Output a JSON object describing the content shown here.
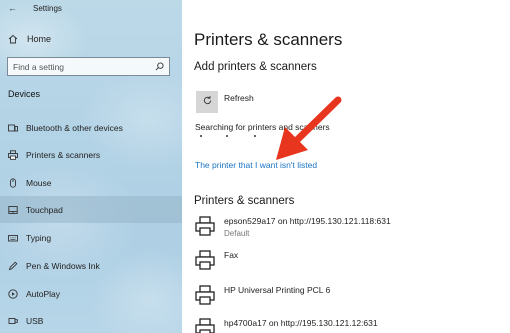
{
  "window": {
    "title": "Settings"
  },
  "sidebar": {
    "home_label": "Home",
    "search": {
      "placeholder": "Find a setting",
      "value": ""
    },
    "section_label": "Devices",
    "items": [
      {
        "label": "Bluetooth & other devices",
        "icon": "bluetooth-devices-icon"
      },
      {
        "label": "Printers & scanners",
        "icon": "printer-icon"
      },
      {
        "label": "Mouse",
        "icon": "mouse-icon"
      },
      {
        "label": "Touchpad",
        "icon": "touchpad-icon",
        "active": true
      },
      {
        "label": "Typing",
        "icon": "keyboard-icon"
      },
      {
        "label": "Pen & Windows Ink",
        "icon": "pen-icon"
      },
      {
        "label": "AutoPlay",
        "icon": "autoplay-icon"
      },
      {
        "label": "USB",
        "icon": "usb-icon"
      }
    ]
  },
  "main": {
    "title": "Printers & scanners",
    "add_section": {
      "heading": "Add printers & scanners",
      "refresh_label": "Refresh",
      "searching_text": "Searching for printers and scanners",
      "not_listed_link": "The printer that I want isn't listed"
    },
    "list_section": {
      "heading": "Printers & scanners",
      "printers": [
        {
          "name": "epson529a17 on http://195.130.121.118:631",
          "status": "Default"
        },
        {
          "name": "Fax",
          "status": ""
        },
        {
          "name": "HP Universal Printing PCL 6",
          "status": ""
        },
        {
          "name": "hp4700a17 on http://195.130.121.12:631",
          "status": ""
        }
      ]
    }
  },
  "colors": {
    "link": "#1a73c2",
    "annotation_arrow": "#e8351e",
    "active_item": "#96b4c8"
  }
}
